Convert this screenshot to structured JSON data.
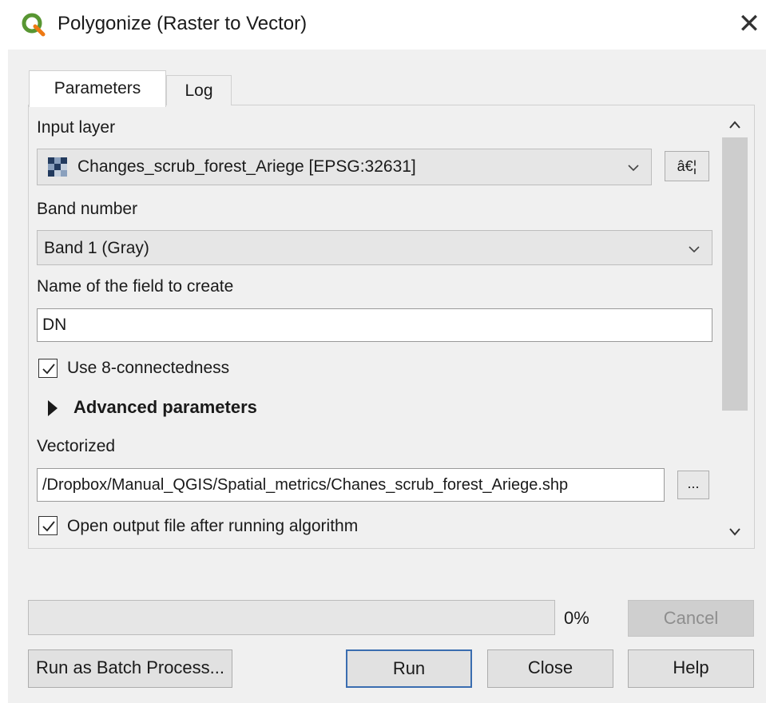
{
  "window": {
    "title": "Polygonize (Raster to Vector)",
    "icon": "qgis-logo-icon",
    "close_glyph": "✕"
  },
  "tabs": [
    {
      "label": "Parameters",
      "active": true
    },
    {
      "label": "Log",
      "active": false
    }
  ],
  "params": {
    "input_layer_label": "Input layer",
    "input_layer_value": "Changes_scrub_forest_Ariege [EPSG:32631]",
    "input_layer_button": "â€¦",
    "band_label": "Band number",
    "band_value": "Band 1 (Gray)",
    "field_label": "Name of the field to create",
    "field_value": "DN",
    "connectedness_label": "Use 8-connectedness",
    "connectedness_checked": true,
    "advanced_label": "Advanced parameters",
    "vectorized_label": "Vectorized",
    "vectorized_value": "/Dropbox/Manual_QGIS/Spatial_metrics/Chanes_scrub_forest_Ariege.shp",
    "vectorized_button": "...",
    "open_output_label": "Open output file after running algorithm",
    "open_output_checked": true
  },
  "scrollbar": {
    "up_glyph": "^",
    "down_glyph": "v"
  },
  "progress": {
    "value": 0,
    "text": "0%"
  },
  "buttons": {
    "cancel": "Cancel",
    "batch": "Run as Batch Process...",
    "run": "Run",
    "close": "Close",
    "help": "Help"
  },
  "colors": {
    "window_bg": "#f0f0f0",
    "default_button_border": "#3a6db0",
    "qgis_green": "#589632",
    "qgis_yellow": "#ee7913"
  }
}
